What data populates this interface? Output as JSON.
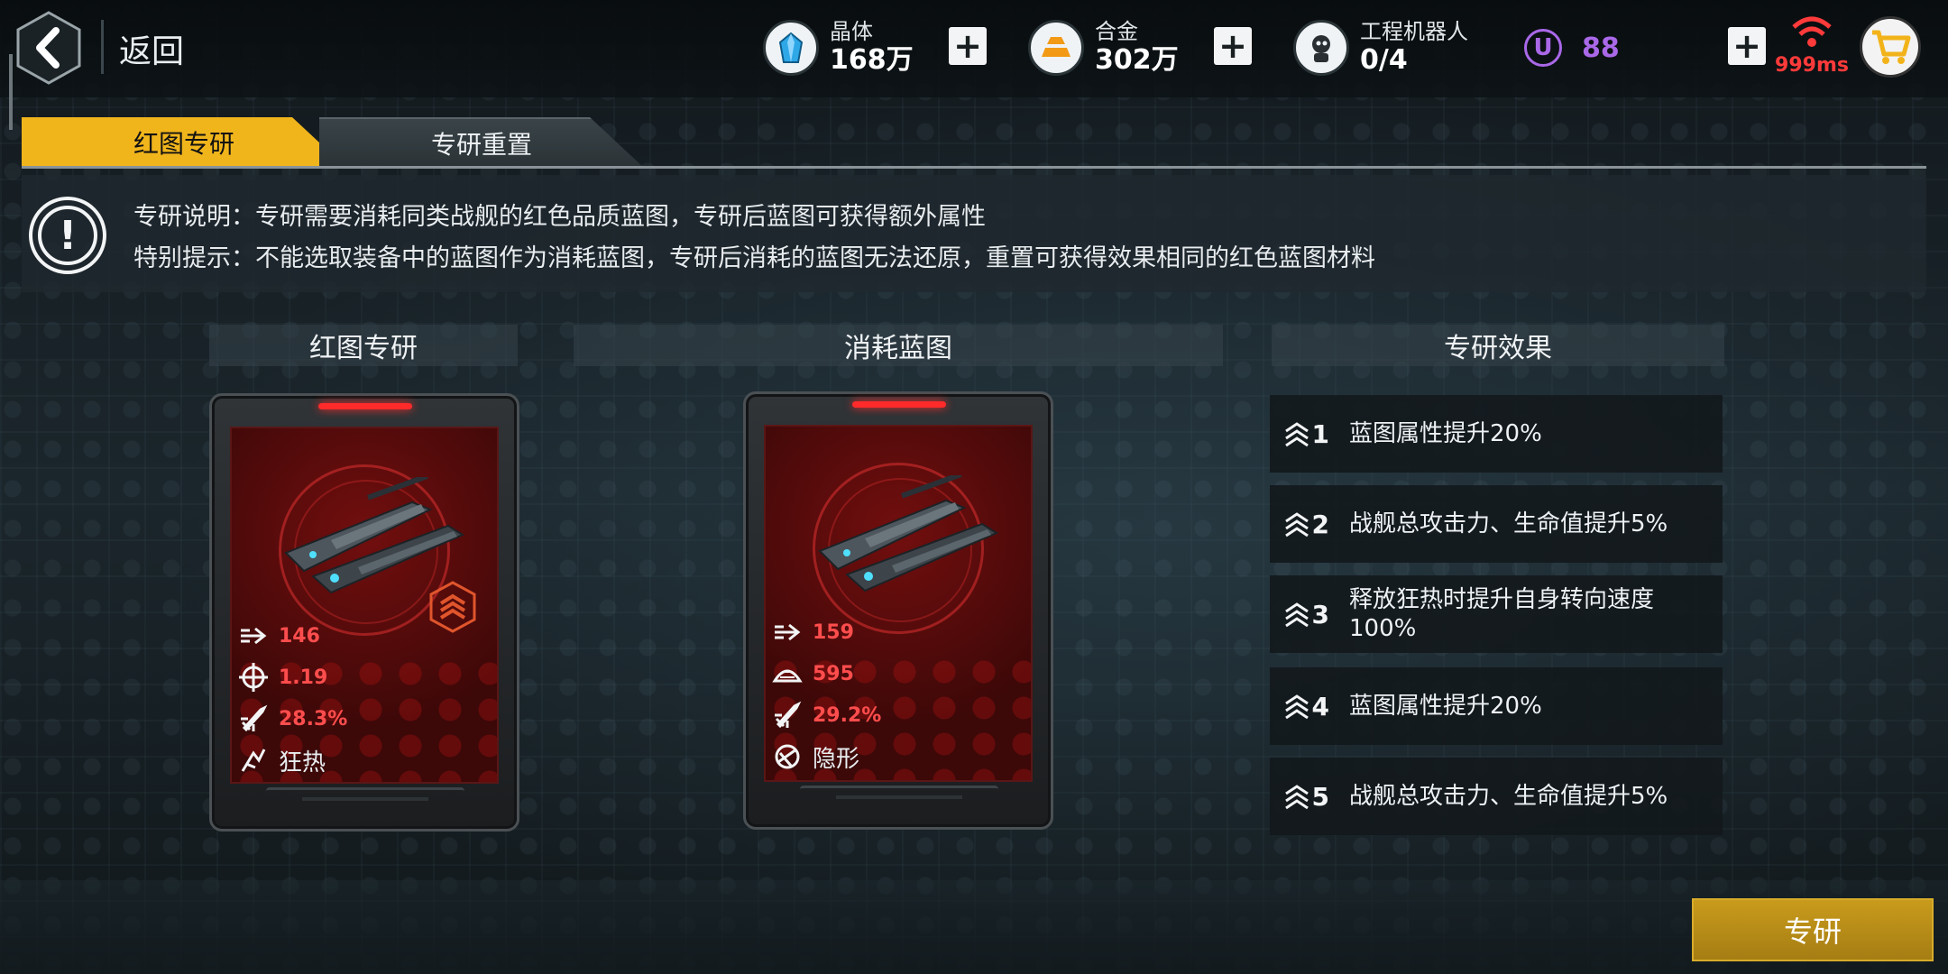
{
  "header": {
    "back_label": "返回",
    "resources": [
      {
        "label": "晶体",
        "value": "168万",
        "icon": "crystal-icon"
      },
      {
        "label": "合金",
        "value": "302万",
        "icon": "alloy-icon"
      },
      {
        "label": "工程机器人",
        "value": "0/4",
        "icon": "robot-icon"
      }
    ],
    "premium": {
      "symbol": "U",
      "value": "88"
    },
    "ping": "999ms",
    "colors": {
      "accent": "#f1b51c",
      "premium": "#a968e8",
      "ping": "#ff3a3a",
      "stat": "#ff4d4d"
    }
  },
  "tabs": [
    {
      "label": "红图专研",
      "active": true
    },
    {
      "label": "专研重置",
      "active": false
    }
  ],
  "notice": {
    "line1": "专研说明：专研需要消耗同类战舰的红色品质蓝图，专研后蓝图可获得额外属性",
    "line2": "特别提示：不能选取装备中的蓝图作为消耗蓝图，专研后消耗的蓝图无法还原，重置可获得效果相同的红色蓝图材料"
  },
  "sections": {
    "red_blueprint": "红图专研",
    "consume_blueprint": "消耗蓝图",
    "effects": "专研效果"
  },
  "cards": {
    "target": {
      "stats": [
        {
          "icon": "arrow-speed-icon",
          "value": "146"
        },
        {
          "icon": "crosshair-icon",
          "value": "1.19"
        },
        {
          "icon": "missile-icon",
          "value": "28.3%"
        }
      ],
      "skill": "狂热",
      "skill_icon": "frenzy-icon"
    },
    "consume": {
      "stats": [
        {
          "icon": "arrow-speed-icon",
          "value": "159"
        },
        {
          "icon": "armor-icon",
          "value": "595"
        },
        {
          "icon": "missile-icon",
          "value": "29.2%"
        }
      ],
      "skill": "隐形",
      "skill_icon": "stealth-icon"
    }
  },
  "effects": [
    {
      "level": "1",
      "text": "蓝图属性提升20%"
    },
    {
      "level": "2",
      "text": "战舰总攻击力、生命值提升5%"
    },
    {
      "level": "3",
      "text": "释放狂热时提升自身转向速度100%"
    },
    {
      "level": "4",
      "text": "蓝图属性提升20%"
    },
    {
      "level": "5",
      "text": "战舰总攻击力、生命值提升5%"
    }
  ],
  "confirm_label": "专研"
}
